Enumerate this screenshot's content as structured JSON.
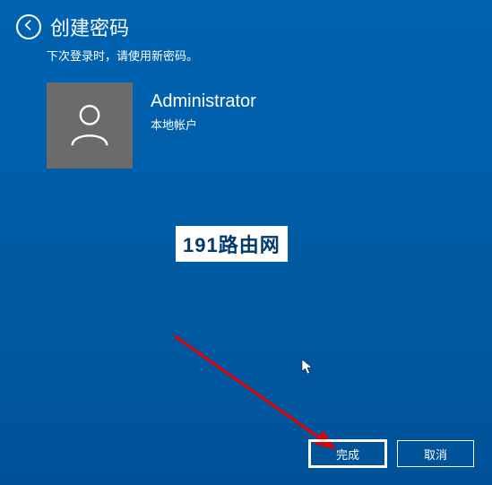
{
  "header": {
    "title": "创建密码",
    "subtitle": "下次登录时，请使用新密码。"
  },
  "account": {
    "name": "Administrator",
    "type": "本地帐户"
  },
  "watermark": "191路由网",
  "buttons": {
    "confirm": "完成",
    "cancel": "取消"
  }
}
